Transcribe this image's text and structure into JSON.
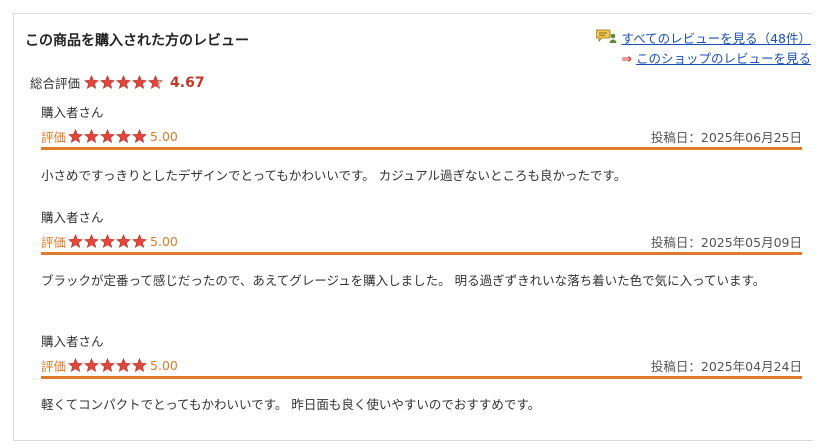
{
  "section": {
    "title": "この商品を購入された方のレビュー",
    "all_reviews_link": "すべてのレビューを見る（48件）",
    "shop_reviews_link": "このショップのレビューを見る",
    "arrow_glyph": "⇒"
  },
  "overall": {
    "label": "総合評価",
    "score": "4.67",
    "rating": 4.67
  },
  "reviews": [
    {
      "reviewer": "購入者さん",
      "rating_label": "評価",
      "rating": "5.00",
      "date": "投稿日：2025年06月25日",
      "text": "小さめですっきりとしたデザインでとってもかわいいです。 カジュアル過ぎないところも良かったです。"
    },
    {
      "reviewer": "購入者さん",
      "rating_label": "評価",
      "rating": "5.00",
      "date": "投稿日：2025年05月09日",
      "text": "ブラックが定番って感じだったので、あえてグレージュを購入しました。 明る過ぎずきれいな落ち着いた色で気に入っています。"
    },
    {
      "reviewer": "購入者さん",
      "rating_label": "評価",
      "rating": "5.00",
      "date": "投稿日：2025年04月24日",
      "text": "軽くてコンパクトでとってもかわいいです。 昨日面も良く使いやすいのでおすすめです。"
    }
  ],
  "colors": {
    "star_fill": "#e0473d",
    "star_empty": "#cccccc",
    "accent_orange": "#e07a2b",
    "link": "#1a4fb8",
    "score_red": "#c0392b"
  },
  "icons": {
    "reviews_link_icon": "speech-bubble-user-icon",
    "star_icon": "star-icon"
  }
}
